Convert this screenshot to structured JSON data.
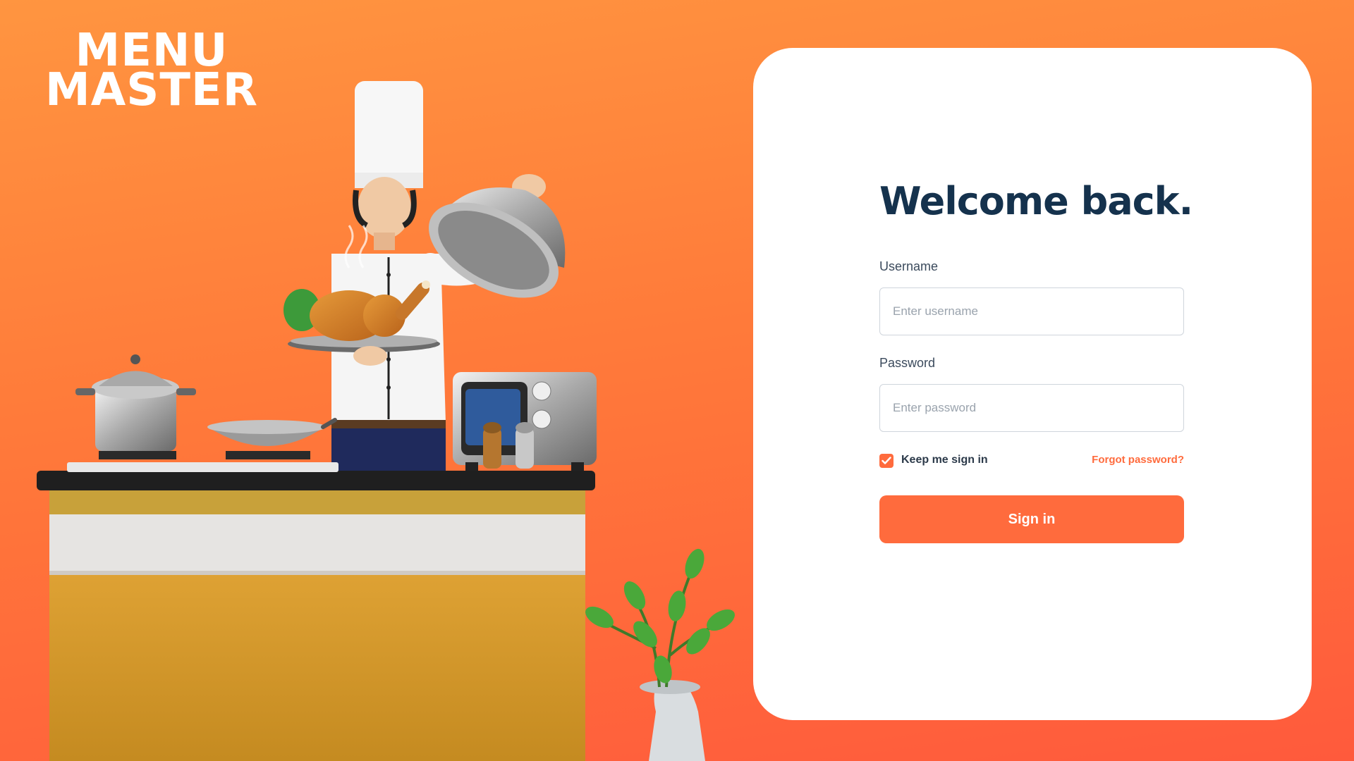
{
  "brand": {
    "line1": "MENU",
    "line2": "MASTER"
  },
  "login": {
    "title": "Welcome back.",
    "username_label": "Username",
    "username_placeholder": "Enter username",
    "password_label": "Password",
    "password_placeholder": "Enter password",
    "keep_signed_in_label": "Keep me sign in",
    "keep_signed_in_checked": true,
    "forgot_password_label": "Forgot password?",
    "submit_label": "Sign in"
  },
  "colors": {
    "accent": "#ff6b3d",
    "title": "#15324d",
    "card": "#ffffff"
  }
}
